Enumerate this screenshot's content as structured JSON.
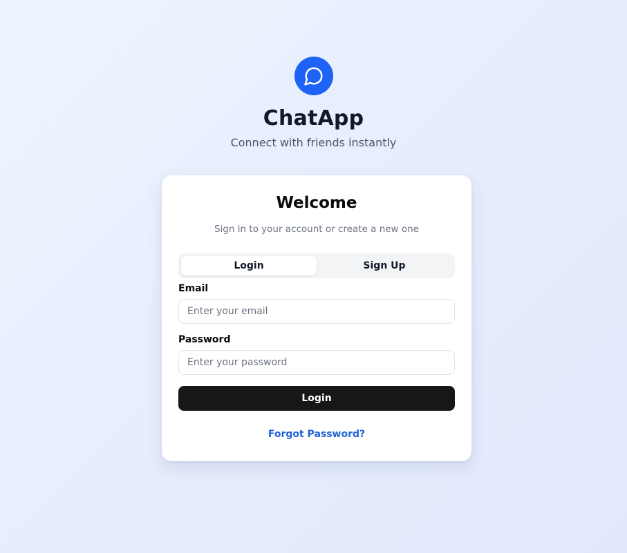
{
  "brand": {
    "icon": "chat-bubble-icon",
    "title": "ChatApp",
    "tagline": "Connect with friends instantly"
  },
  "card": {
    "title": "Welcome",
    "subtitle": "Sign in to your account or create a new one",
    "tabs": [
      {
        "label": "Login",
        "active": true
      },
      {
        "label": "Sign Up",
        "active": false
      }
    ],
    "email": {
      "label": "Email",
      "value": "",
      "placeholder": "Enter your email"
    },
    "password": {
      "label": "Password",
      "value": "",
      "placeholder": "Enter your password"
    },
    "submit_label": "Login",
    "forgot_label": "Forgot Password?"
  },
  "colors": {
    "accent": "#1f63f6",
    "button_bg": "#171717",
    "link": "#1f63d6"
  }
}
